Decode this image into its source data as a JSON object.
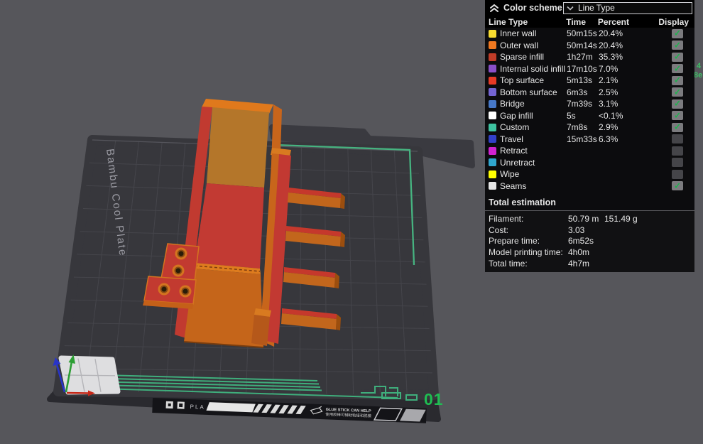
{
  "panel": {
    "title": "Color scheme",
    "dropdown_value": "Line Type",
    "columns": [
      "Line Type",
      "Time",
      "Percent",
      "Display"
    ],
    "rows": [
      {
        "label": "Inner wall",
        "color": "#F8DC30",
        "time": "50m15s",
        "percent": "20.4%",
        "display": true
      },
      {
        "label": "Outer wall",
        "color": "#F07820",
        "time": "50m14s",
        "percent": "20.4%",
        "display": true
      },
      {
        "label": "Sparse infill",
        "color": "#C03C28",
        "time": "1h27m",
        "percent": "35.3%",
        "display": true
      },
      {
        "label": "Internal solid infill",
        "color": "#8A4FC8",
        "time": "17m10s",
        "percent": "7.0%",
        "display": true
      },
      {
        "label": "Top surface",
        "color": "#E83A25",
        "time": "5m13s",
        "percent": "2.1%",
        "display": true
      },
      {
        "label": "Bottom surface",
        "color": "#7464D2",
        "time": "6m3s",
        "percent": "2.5%",
        "display": true
      },
      {
        "label": "Bridge",
        "color": "#4678C8",
        "time": "7m39s",
        "percent": "3.1%",
        "display": true
      },
      {
        "label": "Gap infill",
        "color": "#FFFFFF",
        "time": "5s",
        "percent": "<0.1%",
        "display": true
      },
      {
        "label": "Custom",
        "color": "#3EC3A0",
        "time": "7m8s",
        "percent": "2.9%",
        "display": true
      },
      {
        "label": "Travel",
        "color": "#3240C8",
        "time": "15m33s",
        "percent": "6.3%",
        "display": false
      },
      {
        "label": "Retract",
        "color": "#D122D1",
        "time": "",
        "percent": "",
        "display": false
      },
      {
        "label": "Unretract",
        "color": "#2FA6CE",
        "time": "",
        "percent": "",
        "display": false
      },
      {
        "label": "Wipe",
        "color": "#FFFF00",
        "time": "",
        "percent": "",
        "display": false
      },
      {
        "label": "Seams",
        "color": "#E6E6E6",
        "time": "",
        "percent": "",
        "display": true
      }
    ],
    "totals": {
      "title": "Total estimation",
      "rows": [
        {
          "label": "Filament:",
          "value": "50.79 m",
          "value2": "151.49 g"
        },
        {
          "label": "Cost:",
          "value": "3.03",
          "value2": ""
        },
        {
          "label": "Prepare time:",
          "value": "6m52s",
          "value2": ""
        },
        {
          "label": "Model printing time:",
          "value": "4h0m",
          "value2": ""
        },
        {
          "label": "Total time:",
          "value": "4h7m",
          "value2": ""
        }
      ]
    }
  },
  "viewport": {
    "plate_name": "Bambu Cool Plate",
    "plate_number": "01",
    "strip": {
      "material": "PLA",
      "hint_en": "GLUE STICK CAN HELP",
      "hint_zh": "使用胶棒可辅助粘接和脱模"
    },
    "edge_fragment_1": "4",
    "edge_fragment_2": "8e",
    "colors": {
      "background": "#56565B",
      "plate": "#37373C",
      "plate_grid": "#45454B",
      "accent_green": "#3FAE7C",
      "plate_number_green": "#1FBE52",
      "model_orange": "#C8651B",
      "model_red": "#C23A33",
      "model_brown": "#B4762A",
      "axis_x": "#C62818",
      "axis_y": "#2C9E34",
      "axis_z": "#2834C8"
    }
  }
}
